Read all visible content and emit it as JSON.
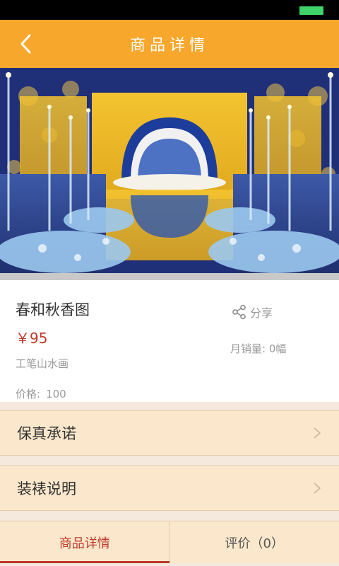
{
  "header": {
    "title": "商品详情"
  },
  "product": {
    "name": "春和秋香图",
    "price": "￥95",
    "subtitle": "工笔山水画",
    "price_label": "价格:",
    "price_value": "100",
    "share_label": "分享",
    "sales_label": "月销量:",
    "sales_value": "0幅"
  },
  "rows": [
    {
      "label": "保真承诺"
    },
    {
      "label": "装裱说明"
    }
  ],
  "tabs": [
    {
      "label": "商品详情",
      "active": true
    },
    {
      "label": "评价（0）",
      "active": false
    }
  ],
  "colors": {
    "nav": "#f7a72c",
    "price": "#c0392b",
    "row_bg": "#fbe8cc",
    "battery": "#3fd46a"
  },
  "icons": {
    "back": "chevron-left-icon",
    "share": "share-icon",
    "row_arrow": "chevron-right-icon"
  }
}
